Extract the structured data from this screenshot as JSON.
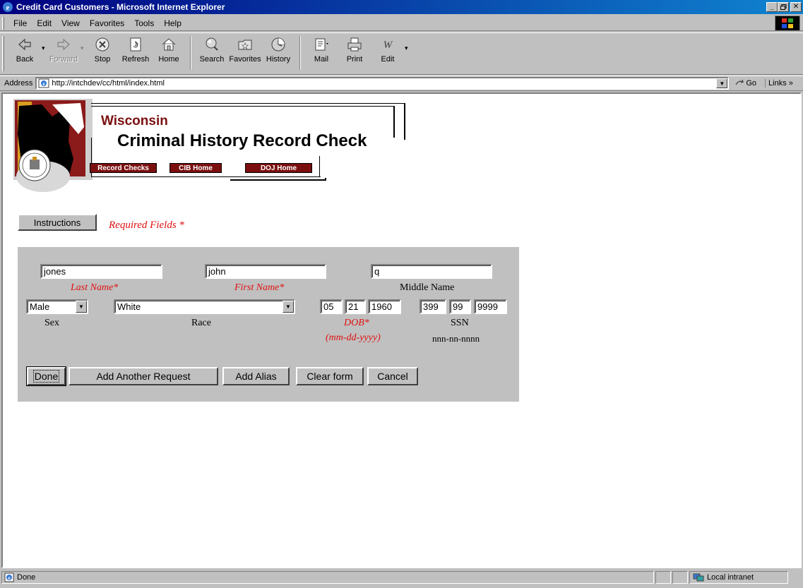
{
  "window": {
    "title": "Credit Card Customers - Microsoft Internet Explorer",
    "minimize": "_",
    "maximize": "▫",
    "close": "✕"
  },
  "menu": {
    "items": [
      "File",
      "Edit",
      "View",
      "Favorites",
      "Tools",
      "Help"
    ]
  },
  "toolbar": {
    "buttons": [
      {
        "label": "Back",
        "icon": "back-arrow-icon"
      },
      {
        "label": "Forward",
        "icon": "forward-arrow-icon"
      },
      {
        "label": "Stop",
        "icon": "stop-icon"
      },
      {
        "label": "Refresh",
        "icon": "refresh-icon"
      },
      {
        "label": "Home",
        "icon": "home-icon"
      },
      {
        "label": "Search",
        "icon": "search-icon"
      },
      {
        "label": "Favorites",
        "icon": "favorites-icon"
      },
      {
        "label": "History",
        "icon": "history-icon"
      },
      {
        "label": "Mail",
        "icon": "mail-icon"
      },
      {
        "label": "Print",
        "icon": "print-icon"
      },
      {
        "label": "Edit",
        "icon": "edit-icon"
      }
    ]
  },
  "address": {
    "label": "Address",
    "url": "http://intchdev/cc/html/index.html",
    "go": "Go",
    "links": "Links »"
  },
  "header": {
    "state": "Wisconsin",
    "title": "Criminal History Record Check",
    "nav": [
      "Record Checks",
      "CIB Home",
      "DOJ Home"
    ]
  },
  "page": {
    "instructions_button": "Instructions",
    "required_note": "Required Fields *"
  },
  "form": {
    "last_name": {
      "value": "jones",
      "label": "Last Name*"
    },
    "first_name": {
      "value": "john",
      "label": "First Name*"
    },
    "middle_name": {
      "value": "q",
      "label": "Middle Name"
    },
    "sex": {
      "value": "Male",
      "label": "Sex"
    },
    "race": {
      "value": "White",
      "label": "Race"
    },
    "dob": {
      "month": "05",
      "day": "21",
      "year": "1960",
      "label": "DOB*",
      "hint": "(mm-dd-yyyy)"
    },
    "ssn": {
      "part1": "399",
      "part2": "99",
      "part3": "9999",
      "label": "SSN",
      "hint": "nnn-nn-nnnn"
    },
    "buttons": {
      "done": "Done",
      "add_request": "Add Another Request",
      "add_alias": "Add Alias",
      "clear": "Clear form",
      "cancel": "Cancel"
    }
  },
  "status": {
    "text": "Done",
    "zone": "Local intranet"
  },
  "colors": {
    "title_bar": "#000080",
    "brand_maroon": "#7b1010",
    "required_red": "#e01010",
    "panel_gray": "#c0c0c0"
  }
}
